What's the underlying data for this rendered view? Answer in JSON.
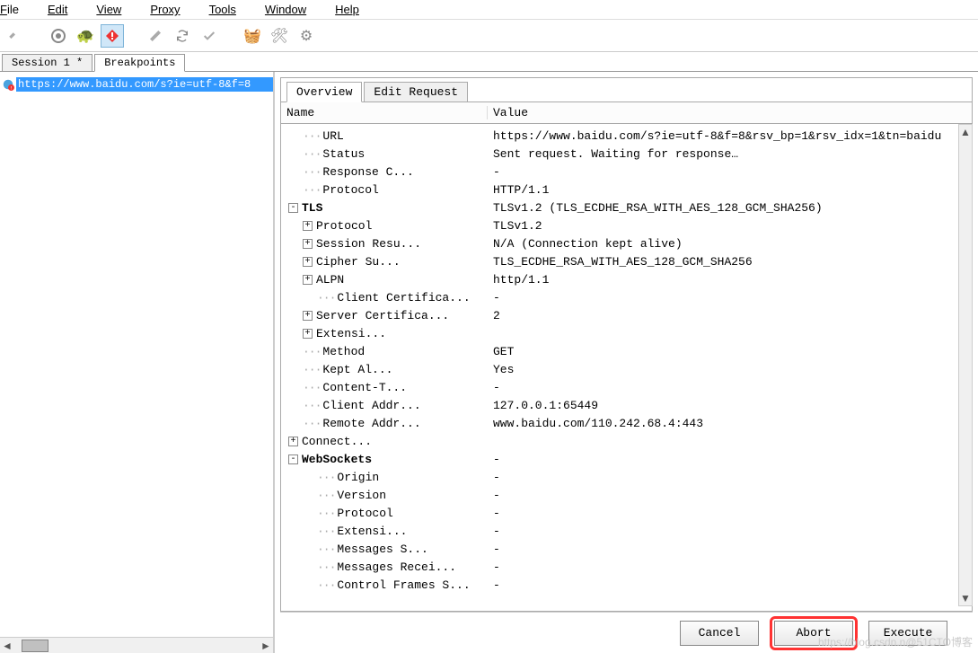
{
  "menu": {
    "file": "ile",
    "edit": "Edit",
    "view": "View",
    "proxy": "Proxy",
    "tools": "Tools",
    "window": "Window",
    "help": "Help"
  },
  "tabs": {
    "session": "Session 1 *",
    "breakpoints": "Breakpoints"
  },
  "left": {
    "url": "https://www.baidu.com/s?ie=utf-8&f=8"
  },
  "sub_tabs": {
    "overview": "Overview",
    "edit_request": "Edit Request"
  },
  "table": {
    "header_name": "Name",
    "header_value": "Value",
    "rows": [
      {
        "indent": 1,
        "toggle": "",
        "name": "URL",
        "value": "https://www.baidu.com/s?ie=utf-8&f=8&rsv_bp=1&rsv_idx=1&tn=baidu"
      },
      {
        "indent": 1,
        "toggle": "",
        "name": "Status",
        "value": "Sent request. Waiting for response…"
      },
      {
        "indent": 1,
        "toggle": "",
        "name": "Response C...",
        "value": "-"
      },
      {
        "indent": 1,
        "toggle": "",
        "name": "Protocol",
        "value": "HTTP/1.1"
      },
      {
        "indent": 0,
        "toggle": "-",
        "name": "TLS",
        "bold": true,
        "value": "TLSv1.2 (TLS_ECDHE_RSA_WITH_AES_128_GCM_SHA256)"
      },
      {
        "indent": 1,
        "toggle": "+",
        "name": "Protocol",
        "value": "TLSv1.2"
      },
      {
        "indent": 1,
        "toggle": "+",
        "name": "Session Resu...",
        "value": "N/A (Connection kept alive)"
      },
      {
        "indent": 1,
        "toggle": "+",
        "name": "Cipher Su...",
        "value": "TLS_ECDHE_RSA_WITH_AES_128_GCM_SHA256"
      },
      {
        "indent": 1,
        "toggle": "+",
        "name": "ALPN",
        "value": "http/1.1"
      },
      {
        "indent": 2,
        "toggle": "",
        "name": "Client Certifica...",
        "value": "-"
      },
      {
        "indent": 1,
        "toggle": "+",
        "name": "Server Certifica...",
        "value": "2"
      },
      {
        "indent": 1,
        "toggle": "+",
        "name": "Extensi...",
        "value": ""
      },
      {
        "indent": 1,
        "toggle": "",
        "name": "Method",
        "value": "GET"
      },
      {
        "indent": 1,
        "toggle": "",
        "name": "Kept Al...",
        "value": "Yes"
      },
      {
        "indent": 1,
        "toggle": "",
        "name": "Content-T...",
        "value": "-"
      },
      {
        "indent": 1,
        "toggle": "",
        "name": "Client Addr...",
        "value": "127.0.0.1:65449"
      },
      {
        "indent": 1,
        "toggle": "",
        "name": "Remote Addr...",
        "value": "www.baidu.com/110.242.68.4:443"
      },
      {
        "indent": 0,
        "toggle": "+",
        "name": "Connect...",
        "value": ""
      },
      {
        "indent": 0,
        "toggle": "-",
        "name": "WebSockets",
        "bold": true,
        "value": "-"
      },
      {
        "indent": 2,
        "toggle": "",
        "name": "Origin",
        "value": "-"
      },
      {
        "indent": 2,
        "toggle": "",
        "name": "Version",
        "value": "-"
      },
      {
        "indent": 2,
        "toggle": "",
        "name": "Protocol",
        "value": "-"
      },
      {
        "indent": 2,
        "toggle": "",
        "name": "Extensi...",
        "value": "-"
      },
      {
        "indent": 2,
        "toggle": "",
        "name": "Messages S...",
        "value": "-"
      },
      {
        "indent": 2,
        "toggle": "",
        "name": "Messages Recei...",
        "value": "-"
      },
      {
        "indent": 2,
        "toggle": "",
        "name": "Control Frames S...",
        "value": "-"
      }
    ]
  },
  "buttons": {
    "cancel": "Cancel",
    "abort": "Abort",
    "execute": "Execute"
  },
  "watermark": "https://blog.csdn.n@51CTO博客"
}
